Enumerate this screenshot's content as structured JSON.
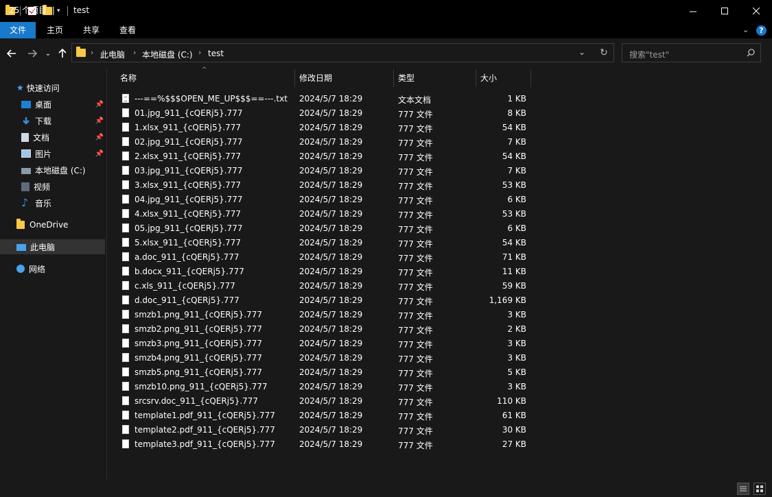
{
  "window": {
    "title": "test",
    "minimize_icon": "minimize-icon",
    "maximize_icon": "maximize-icon",
    "close_icon": "close-icon"
  },
  "ribbon": {
    "tabs": [
      "文件",
      "主页",
      "共享",
      "查看"
    ],
    "active_tab": "文件",
    "accent": "#1979ca"
  },
  "address": {
    "crumbs": [
      "此电脑",
      "本地磁盘 (C:)",
      "test"
    ]
  },
  "search": {
    "placeholder": "搜索\"test\""
  },
  "nav": {
    "quick_access": "快速访问",
    "items": [
      {
        "label": "桌面",
        "icon": "desktop-icon",
        "pinned": true
      },
      {
        "label": "下载",
        "icon": "download-icon",
        "pinned": true
      },
      {
        "label": "文档",
        "icon": "documents-icon",
        "pinned": true
      },
      {
        "label": "图片",
        "icon": "pictures-icon",
        "pinned": true
      },
      {
        "label": "本地磁盘 (C:)",
        "icon": "drive-icon",
        "pinned": false
      },
      {
        "label": "视频",
        "icon": "videos-icon",
        "pinned": false
      },
      {
        "label": "音乐",
        "icon": "music-icon",
        "pinned": false
      }
    ],
    "onedrive": "OneDrive",
    "this_pc": "此电脑",
    "network": "网络"
  },
  "columns": {
    "name": "名称",
    "date": "修改日期",
    "type": "类型",
    "size": "大小"
  },
  "files": [
    {
      "name": "---==%$$$OPEN_ME_UP$$$==---.txt",
      "date": "2024/5/7 18:29",
      "type": "文本文档",
      "size": "1 KB"
    },
    {
      "name": "01.jpg_911_{cQERj5}.777",
      "date": "2024/5/7 18:29",
      "type": "777 文件",
      "size": "8 KB"
    },
    {
      "name": "1.xlsx_911_{cQERj5}.777",
      "date": "2024/5/7 18:29",
      "type": "777 文件",
      "size": "54 KB"
    },
    {
      "name": "02.jpg_911_{cQERj5}.777",
      "date": "2024/5/7 18:29",
      "type": "777 文件",
      "size": "7 KB"
    },
    {
      "name": "2.xlsx_911_{cQERj5}.777",
      "date": "2024/5/7 18:29",
      "type": "777 文件",
      "size": "54 KB"
    },
    {
      "name": "03.jpg_911_{cQERj5}.777",
      "date": "2024/5/7 18:29",
      "type": "777 文件",
      "size": "7 KB"
    },
    {
      "name": "3.xlsx_911_{cQERj5}.777",
      "date": "2024/5/7 18:29",
      "type": "777 文件",
      "size": "53 KB"
    },
    {
      "name": "04.jpg_911_{cQERj5}.777",
      "date": "2024/5/7 18:29",
      "type": "777 文件",
      "size": "6 KB"
    },
    {
      "name": "4.xlsx_911_{cQERj5}.777",
      "date": "2024/5/7 18:29",
      "type": "777 文件",
      "size": "53 KB"
    },
    {
      "name": "05.jpg_911_{cQERj5}.777",
      "date": "2024/5/7 18:29",
      "type": "777 文件",
      "size": "6 KB"
    },
    {
      "name": "5.xlsx_911_{cQERj5}.777",
      "date": "2024/5/7 18:29",
      "type": "777 文件",
      "size": "54 KB"
    },
    {
      "name": "a.doc_911_{cQERj5}.777",
      "date": "2024/5/7 18:29",
      "type": "777 文件",
      "size": "71 KB"
    },
    {
      "name": "b.docx_911_{cQERj5}.777",
      "date": "2024/5/7 18:29",
      "type": "777 文件",
      "size": "11 KB"
    },
    {
      "name": "c.xls_911_{cQERj5}.777",
      "date": "2024/5/7 18:29",
      "type": "777 文件",
      "size": "59 KB"
    },
    {
      "name": "d.doc_911_{cQERj5}.777",
      "date": "2024/5/7 18:29",
      "type": "777 文件",
      "size": "1,169 KB"
    },
    {
      "name": "smzb1.png_911_{cQERj5}.777",
      "date": "2024/5/7 18:29",
      "type": "777 文件",
      "size": "3 KB"
    },
    {
      "name": "smzb2.png_911_{cQERj5}.777",
      "date": "2024/5/7 18:29",
      "type": "777 文件",
      "size": "2 KB"
    },
    {
      "name": "smzb3.png_911_{cQERj5}.777",
      "date": "2024/5/7 18:29",
      "type": "777 文件",
      "size": "3 KB"
    },
    {
      "name": "smzb4.png_911_{cQERj5}.777",
      "date": "2024/5/7 18:29",
      "type": "777 文件",
      "size": "3 KB"
    },
    {
      "name": "smzb5.png_911_{cQERj5}.777",
      "date": "2024/5/7 18:29",
      "type": "777 文件",
      "size": "5 KB"
    },
    {
      "name": "smzb10.png_911_{cQERj5}.777",
      "date": "2024/5/7 18:29",
      "type": "777 文件",
      "size": "3 KB"
    },
    {
      "name": "srcsrv.doc_911_{cQERj5}.777",
      "date": "2024/5/7 18:29",
      "type": "777 文件",
      "size": "110 KB"
    },
    {
      "name": "template1.pdf_911_{cQERj5}.777",
      "date": "2024/5/7 18:29",
      "type": "777 文件",
      "size": "61 KB"
    },
    {
      "name": "template2.pdf_911_{cQERj5}.777",
      "date": "2024/5/7 18:29",
      "type": "777 文件",
      "size": "30 KB"
    },
    {
      "name": "template3.pdf_911_{cQERj5}.777",
      "date": "2024/5/7 18:29",
      "type": "777 文件",
      "size": "27 KB"
    }
  ],
  "status": {
    "item_count": "25 个项目"
  }
}
